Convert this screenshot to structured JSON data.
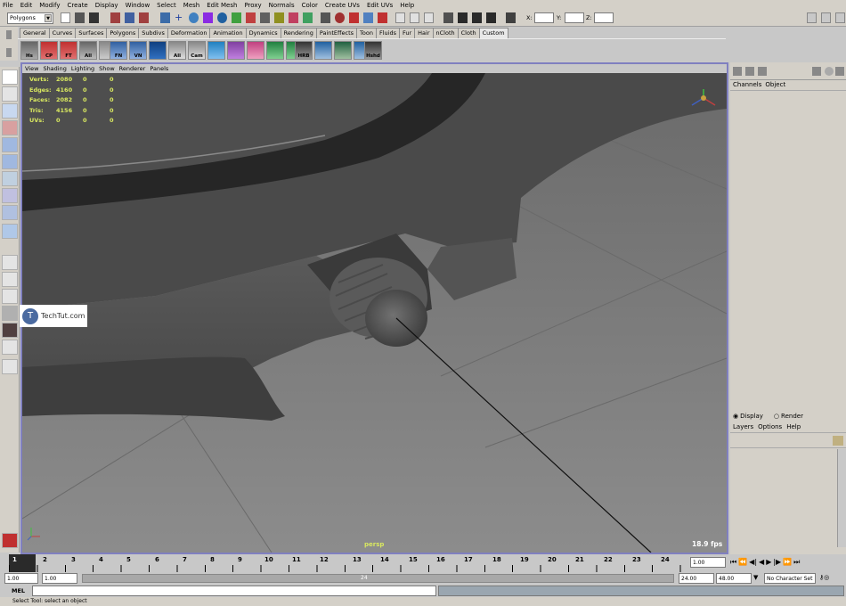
{
  "menubar": [
    "File",
    "Edit",
    "Modify",
    "Create",
    "Display",
    "Window",
    "Select",
    "Mesh",
    "Edit Mesh",
    "Proxy",
    "Normals",
    "Color",
    "Create UVs",
    "Edit UVs",
    "Help"
  ],
  "status_line": {
    "mode": "Polygons",
    "x_label": "X:",
    "y_label": "Y:",
    "z_label": "Z:"
  },
  "shelf_tabs": [
    "General",
    "Curves",
    "Surfaces",
    "Polygons",
    "Subdivs",
    "Deformation",
    "Animation",
    "Dynamics",
    "Rendering",
    "PaintEffects",
    "Toon",
    "Fluids",
    "Fur",
    "Hair",
    "nCloth",
    "Cloth",
    "Custom"
  ],
  "active_shelf_tab": "Custom",
  "shelf_buttons": [
    "Hs",
    "CP",
    "FT",
    "All",
    "",
    "FN",
    "VN",
    "",
    "All",
    "Cam",
    "",
    "",
    "",
    "",
    "",
    "HRB",
    "",
    "",
    "",
    "Hshd"
  ],
  "panel_menu": [
    "View",
    "Shading",
    "Lighting",
    "Show",
    "Renderer",
    "Panels"
  ],
  "hud": [
    {
      "label": "Verts:",
      "a": "2080",
      "b": "0",
      "c": "0"
    },
    {
      "label": "Edges:",
      "a": "4160",
      "b": "0",
      "c": "0"
    },
    {
      "label": "Faces:",
      "a": "2082",
      "b": "0",
      "c": "0"
    },
    {
      "label": "Tris:",
      "a": "4156",
      "b": "0",
      "c": "0"
    },
    {
      "label": "UVs:",
      "a": "0",
      "b": "0",
      "c": "0"
    }
  ],
  "camera_name": "persp",
  "fps": "18.9 fps",
  "watermark": "TechTut.com",
  "channel_box": {
    "channels": "Channels",
    "object": "Object"
  },
  "layer_editor": {
    "display": "Display",
    "render": "Render",
    "layers": "Layers",
    "options": "Options",
    "help": "Help"
  },
  "timeline_ticks": [
    "1",
    "2",
    "3",
    "4",
    "5",
    "6",
    "7",
    "8",
    "9",
    "10",
    "11",
    "12",
    "13",
    "14",
    "15",
    "16",
    "17",
    "18",
    "19",
    "20",
    "21",
    "22",
    "23",
    "24"
  ],
  "current_frame": "1.00",
  "range": {
    "start": "1.00",
    "inner_start": "1.00",
    "slider_label": "24",
    "inner_end": "24.00",
    "end": "48.00",
    "char_set": "No Character Set"
  },
  "command_line": {
    "label": "MEL"
  },
  "help_line": "Select Tool: select an object",
  "colors": {
    "viewport_bg": "#5e5e5e",
    "hud_text": "#d9e860",
    "panel": "#d4d0c8"
  }
}
